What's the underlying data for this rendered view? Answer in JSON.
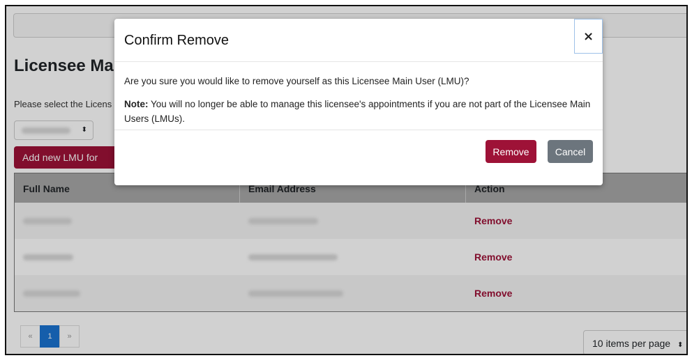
{
  "page": {
    "title": "Licensee Mai",
    "select_label": "Please select the Licens",
    "add_button_label": "Add new LMU for"
  },
  "table": {
    "headers": [
      "Full Name",
      "Email Address",
      "Action"
    ],
    "rows": [
      {
        "action": "Remove"
      },
      {
        "action": "Remove"
      },
      {
        "action": "Remove"
      }
    ]
  },
  "pagination": {
    "prev": "«",
    "current": "1",
    "next": "»",
    "per_page": "10 items per page"
  },
  "modal": {
    "title": "Confirm Remove",
    "close": "×",
    "question": "Are you sure you would like to remove yourself as this Licensee Main User (LMU)?",
    "note_label": "Note:",
    "note_text": " You will no longer be able to manage this licensee's appointments if you are not part of the Licensee Main Users (LMUs).",
    "remove_label": "Remove",
    "cancel_label": "Cancel"
  },
  "colors": {
    "accent": "#9e1237",
    "secondary": "#6c757d",
    "pager_active": "#1a73d1"
  }
}
